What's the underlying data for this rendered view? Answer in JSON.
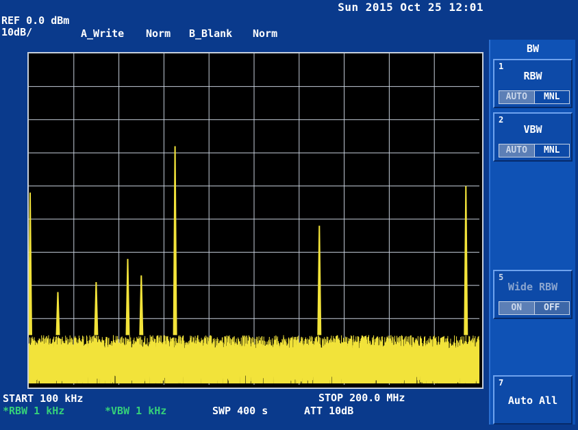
{
  "status": {
    "datetime": "Sun 2015 Oct 25 12:01"
  },
  "header": {
    "ref_level": "REF 0.0 dBm",
    "scale": "10dB/",
    "trace_a": "A_Write",
    "trace_a_det": "Norm",
    "trace_b": "B_Blank",
    "trace_b_det": "Norm"
  },
  "footer": {
    "start": "START 100 kHz",
    "stop": "STOP 200.0 MHz",
    "rbw": "*RBW 1 kHz",
    "vbw": "*VBW 1 kHz",
    "sweep": "SWP 400 s",
    "attenuation": "ATT 10dB"
  },
  "menu": {
    "title": "BW",
    "keys": [
      {
        "num": "1",
        "label": "RBW",
        "options": [
          "AUTO",
          "MNL"
        ],
        "selected": "MNL",
        "enabled": true
      },
      {
        "num": "2",
        "label": "VBW",
        "options": [
          "AUTO",
          "MNL"
        ],
        "selected": "MNL",
        "enabled": true
      },
      {
        "num": "5",
        "label": "Wide RBW",
        "options": [
          "ON",
          "OFF"
        ],
        "selected": "OFF",
        "enabled": false
      },
      {
        "num": "7",
        "label": "Auto All"
      }
    ]
  },
  "colors": {
    "background": "#0a3a8c",
    "panel": "#0f52b5",
    "trace": "#f2e33a",
    "grid": "#c7d0dc",
    "setting_changed": "#35d07a"
  },
  "chart_data": {
    "type": "line",
    "x_unit": "MHz",
    "y_unit": "dBm",
    "xlim": [
      0.1,
      200.0
    ],
    "ylim": [
      -100,
      0
    ],
    "grid": true,
    "x_divisions": 10,
    "y_divisions": 10,
    "noise_floor_dbm": -85,
    "series": [
      {
        "peaks": [
          {
            "x": 0.1,
            "y": -42
          },
          {
            "x": 13.0,
            "y": -72
          },
          {
            "x": 30.0,
            "y": -69
          },
          {
            "x": 44.0,
            "y": -62
          },
          {
            "x": 50.0,
            "y": -67
          },
          {
            "x": 65.0,
            "y": -28
          },
          {
            "x": 129.0,
            "y": -52
          },
          {
            "x": 194.0,
            "y": -40
          }
        ]
      }
    ]
  }
}
